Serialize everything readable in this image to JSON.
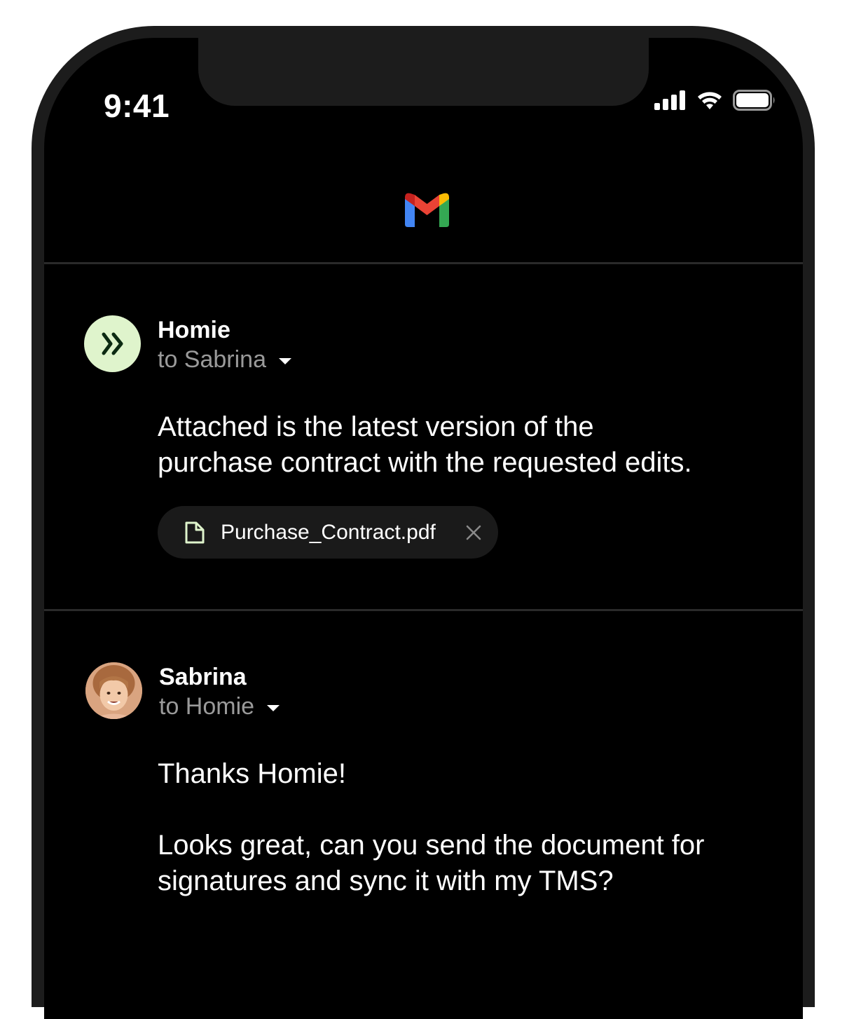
{
  "status_bar": {
    "time": "9:41"
  },
  "header": {
    "app_icon": "gmail-logo"
  },
  "messages": [
    {
      "sender": "Homie",
      "recipient": "to Sabrina",
      "body_lines": [
        "Attached is the latest version of the",
        "purchase contract with the requested edits."
      ],
      "avatar_icon": "double-chevron-right-icon",
      "avatar_color": "#dff4cc",
      "attachment": {
        "file_name": "Purchase_Contract.pdf",
        "icon": "document-icon",
        "remove_icon": "close-icon"
      }
    },
    {
      "sender": "Sabrina",
      "recipient": "to Homie",
      "body_paragraphs": [
        "Thanks Homie!",
        "Looks great, can you send the document for",
        "signatures and sync it with my TMS?"
      ],
      "avatar_icon": "user-photo"
    }
  ],
  "colors": {
    "background": "#000000",
    "frame": "#1c1c1c",
    "secondary_text": "#9a9a9a",
    "accent_green": "#dff4cc"
  }
}
